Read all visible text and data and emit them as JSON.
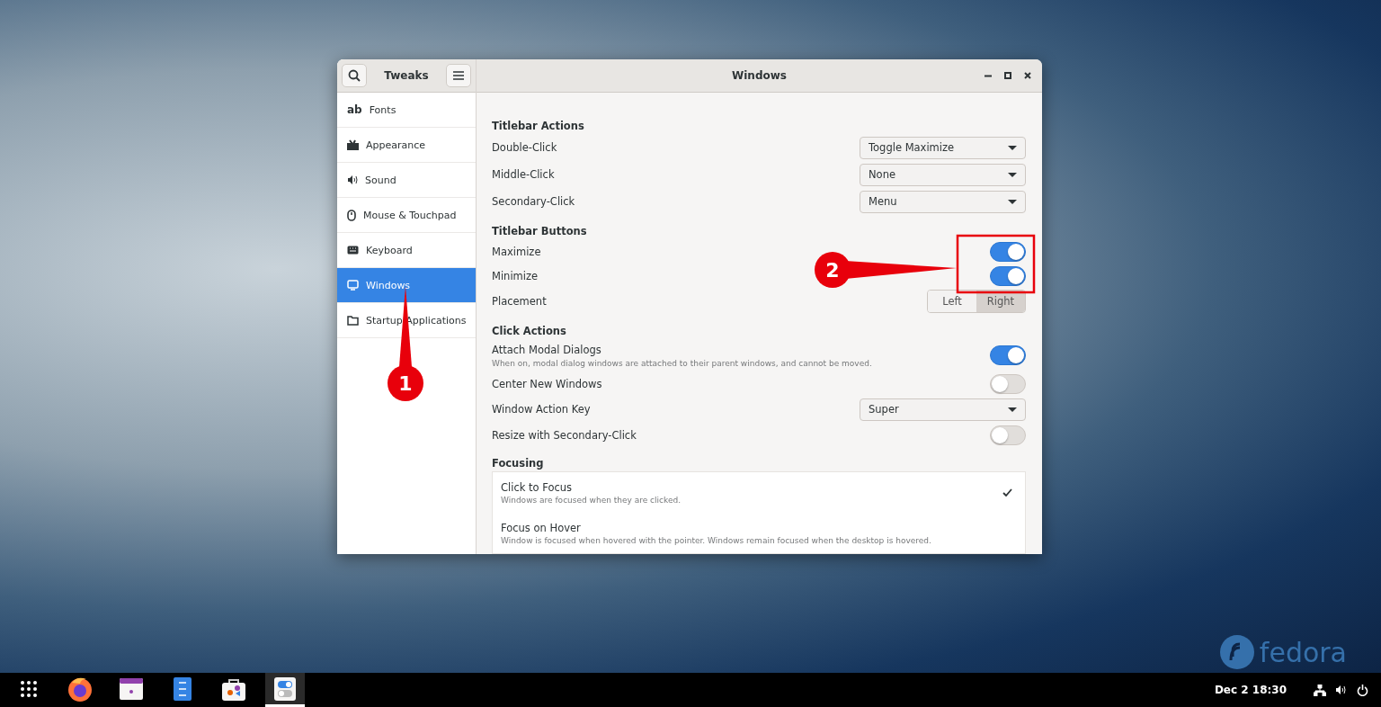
{
  "window": {
    "sidebar_title": "Tweaks",
    "title": "Windows"
  },
  "sidebar": {
    "items": [
      {
        "label": "Fonts",
        "icon_text": "ab",
        "selected": false
      },
      {
        "label": "Appearance",
        "selected": false
      },
      {
        "label": "Sound",
        "selected": false
      },
      {
        "label": "Mouse & Touchpad",
        "selected": false
      },
      {
        "label": "Keyboard",
        "selected": false
      },
      {
        "label": "Windows",
        "selected": true
      },
      {
        "label": "Startup Applications",
        "selected": false
      }
    ]
  },
  "sections": [
    {
      "title": "Titlebar Actions",
      "rows": [
        {
          "kind": "dropdown",
          "label": "Double-Click",
          "value": "Toggle Maximize"
        },
        {
          "kind": "dropdown",
          "label": "Middle-Click",
          "value": "None"
        },
        {
          "kind": "dropdown",
          "label": "Secondary-Click",
          "value": "Menu"
        }
      ]
    },
    {
      "title": "Titlebar Buttons",
      "rows": [
        {
          "kind": "toggle",
          "label": "Maximize",
          "on": true
        },
        {
          "kind": "toggle",
          "label": "Minimize",
          "on": true
        },
        {
          "kind": "segmented",
          "label": "Placement",
          "options": [
            {
              "label": "Left",
              "selected": false
            },
            {
              "label": "Right",
              "selected": true
            }
          ]
        }
      ]
    },
    {
      "title": "Click Actions",
      "rows": [
        {
          "kind": "toggle",
          "label": "Attach Modal Dialogs",
          "description": "When on, modal dialog windows are attached to their parent windows, and cannot be moved.",
          "on": true
        },
        {
          "kind": "toggle",
          "label": "Center New Windows",
          "on": false
        },
        {
          "kind": "dropdown",
          "label": "Window Action Key",
          "value": "Super"
        },
        {
          "kind": "toggle",
          "label": "Resize with Secondary-Click",
          "on": false
        }
      ]
    }
  ],
  "focusing": {
    "title": "Focusing",
    "options": [
      {
        "label": "Click to Focus",
        "description": "Windows are focused when they are clicked.",
        "selected": true
      },
      {
        "label": "Focus on Hover",
        "description": "Window is focused when hovered with the pointer. Windows remain focused when the desktop is hovered.",
        "selected": false
      }
    ]
  },
  "annotations": [
    {
      "label": "1"
    },
    {
      "label": "2"
    }
  ],
  "desktop": {
    "logo_text": "fedora"
  },
  "taskbar": {
    "apps": [
      {
        "selected": false
      },
      {
        "selected": false
      },
      {
        "selected": false
      },
      {
        "selected": false
      },
      {
        "selected": false
      },
      {
        "selected": true
      }
    ],
    "clock": "Dec 2  18:30"
  }
}
